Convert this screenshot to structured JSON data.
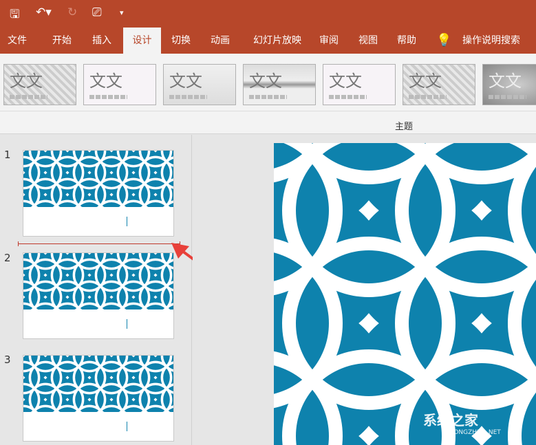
{
  "quick_access": {
    "icons": [
      "save-icon",
      "undo-icon",
      "redo-icon",
      "present-from-start-icon",
      "customize-qat-icon"
    ]
  },
  "tabs": [
    "文件",
    "开始",
    "插入",
    "设计",
    "切换",
    "动画",
    "幻灯片放映",
    "审阅",
    "视图",
    "帮助"
  ],
  "active_tab": "设计",
  "tell_me": "操作说明搜索",
  "themes": [
    "文文",
    "文文",
    "文文",
    "文文",
    "文文",
    "文文",
    "文文"
  ],
  "group_label": "主题",
  "slides": [
    "1",
    "2",
    "3"
  ],
  "colors": {
    "accent": "#b7472a",
    "slide_blue": "#0e82ad",
    "insert_marker": "#c0392b"
  },
  "watermark": {
    "text": "系统之家",
    "sub": "XITONGZHIJIA.NET"
  }
}
